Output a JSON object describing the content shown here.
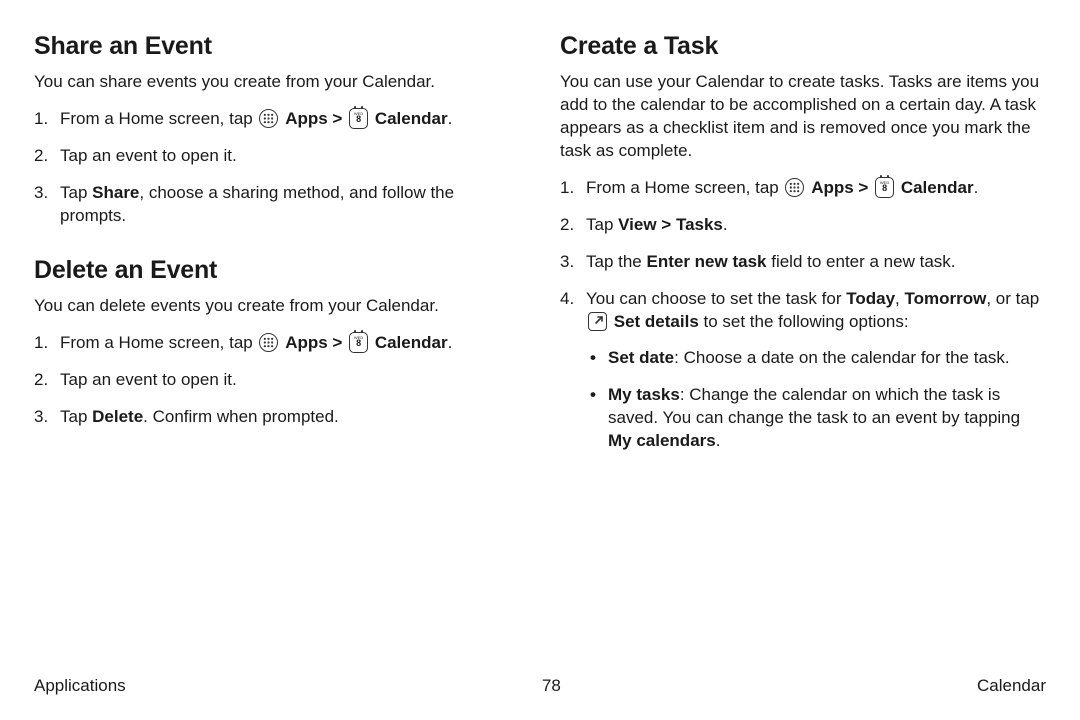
{
  "left": {
    "share": {
      "heading": "Share an Event",
      "intro": "You can share events you create from your Calendar.",
      "step1_pre": "From a Home screen, tap ",
      "apps_label": "Apps",
      "sep": " > ",
      "cal_label": "Calendar",
      "step1_post": ".",
      "step2": "Tap an event to open it.",
      "step3_pre": "Tap ",
      "step3_b": "Share",
      "step3_post": ", choose a sharing method, and follow the prompts."
    },
    "delete": {
      "heading": "Delete an Event",
      "intro": "You can delete events you create from your Calendar.",
      "step1_pre": "From a Home screen, tap ",
      "apps_label": "Apps",
      "sep": " > ",
      "cal_label": "Calendar",
      "step1_post": ".",
      "step2": "Tap an event to open it.",
      "step3_pre": "Tap ",
      "step3_b": "Delete",
      "step3_post": ". Confirm when prompted."
    }
  },
  "right": {
    "heading": "Create a Task",
    "intro": "You can use your Calendar to create tasks. Tasks are items you add to the calendar to be accomplished on a certain day. A task appears as a checklist item and is removed once you mark the task as complete.",
    "step1_pre": "From a Home screen, tap ",
    "apps_label": "Apps",
    "sep": " > ",
    "cal_label": "Calendar",
    "step1_post": ".",
    "step2_pre": "Tap ",
    "step2_b": "View > Tasks",
    "step2_post": ".",
    "step3_pre": "Tap the ",
    "step3_b": "Enter new task",
    "step3_post": " field to enter a new task.",
    "step4_pre": "You can choose to set the task for ",
    "step4_b1": "Today",
    "step4_mid1": ", ",
    "step4_b2": "Tomorrow",
    "step4_mid2": ", or tap ",
    "step4_b3": "Set details",
    "step4_post": " to set the following options:",
    "sub1_b": "Set date",
    "sub1_post": ": Choose a date on the calendar for the task.",
    "sub2_b": "My tasks",
    "sub2_mid": ": Change the calendar on which the task is saved. You can change the task to an event by tapping ",
    "sub2_b2": "My calendars",
    "sub2_post": "."
  },
  "footer": {
    "left": "Applications",
    "center": "78",
    "right": "Calendar"
  },
  "icons": {
    "cal_day": "WED",
    "cal_num": "8"
  }
}
